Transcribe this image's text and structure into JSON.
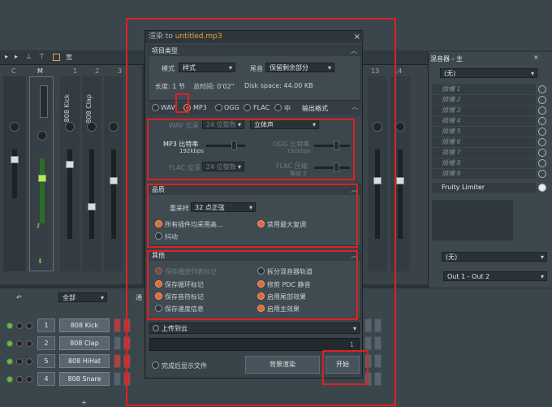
{
  "dialog": {
    "title_prefix": "渲染 to",
    "filename": "untitled.mp3",
    "close": "×",
    "project_type": {
      "header": "项目类型",
      "mode_label": "模式",
      "mode_value": "样式",
      "tail_label": "尾音",
      "tail_value": "保留剩余部分",
      "length": "长度: 1 节",
      "total_time": "总时间: 0'02\"",
      "disk_space": "Disk space: 44.00 KB"
    },
    "formats": {
      "wav": "WAV",
      "mp3": "MP3",
      "ogg": "OGG",
      "flac": "FLAC",
      "mid": "中",
      "output_label": "输出格式"
    },
    "format_options": {
      "wav_depth_label": "WAV 位深",
      "wav_depth_value": "24 位整数",
      "stereo_value": "立体声",
      "mp3_bitrate_label": "MP3 比特率",
      "mp3_bitrate_value": "192kbps",
      "ogg_bitrate_label": "OGG 比特率",
      "ogg_bitrate_value": "192kbps",
      "flac_depth_label": "FLAC 位深",
      "flac_depth_value": "24 位整数",
      "flac_comp_label": "FLAC 压缩",
      "flac_comp_value": "等级 5"
    },
    "quality": {
      "header": "品质",
      "resample_label": "重采样",
      "resample_value": "32 点正弦",
      "opt1": "所有插件均采用高...",
      "opt2": "禁用最大复调",
      "opt3": "抖动"
    },
    "other": {
      "header": "其他",
      "o1": "保存播放列表标记",
      "o2": "拆分混音器轨道",
      "o3": "保存循环标记",
      "o4": "修剪 PDC 静音",
      "o5": "保存音符标记",
      "o6": "启用尾部效果",
      "o7": "保存速度信息",
      "o8": "启用主效果"
    },
    "upload_value": "上传到云",
    "progress_value": "1",
    "show_file_after": "完成后显示文件",
    "bg_render_button": "背景渲染",
    "start_button": "开始"
  },
  "mixer": {
    "insert_c": "C",
    "insert_m": "M",
    "num_1": "1",
    "num_2": "2",
    "num_3": "3",
    "num_13": "13",
    "num_14": "14",
    "label_1": "808 Kick",
    "label_2": "808 Clap",
    "label_3": "808 HiHat",
    "label_4": "808 Snare"
  },
  "right_panel": {
    "title": "混音器 - 主",
    "preset": "(无)",
    "slots": [
      "插槽 1",
      "插槽 2",
      "插槽 3",
      "插槽 4",
      "插槽 5",
      "插槽 6",
      "插槽 7",
      "插槽 8",
      "插槽 9"
    ],
    "limiter": "Fruity Limiter",
    "preset2": "(无)",
    "output": "Out 1 - Out 2"
  },
  "toolbar": {
    "label": "宽"
  },
  "channel_rack": {
    "filter": "全部",
    "tab_hint": "通",
    "channels": [
      {
        "num": "1",
        "name": "808 Kick"
      },
      {
        "num": "2",
        "name": "808 Clap"
      },
      {
        "num": "5",
        "name": "808 HiHat"
      },
      {
        "num": "4",
        "name": "808 Snare"
      }
    ]
  }
}
